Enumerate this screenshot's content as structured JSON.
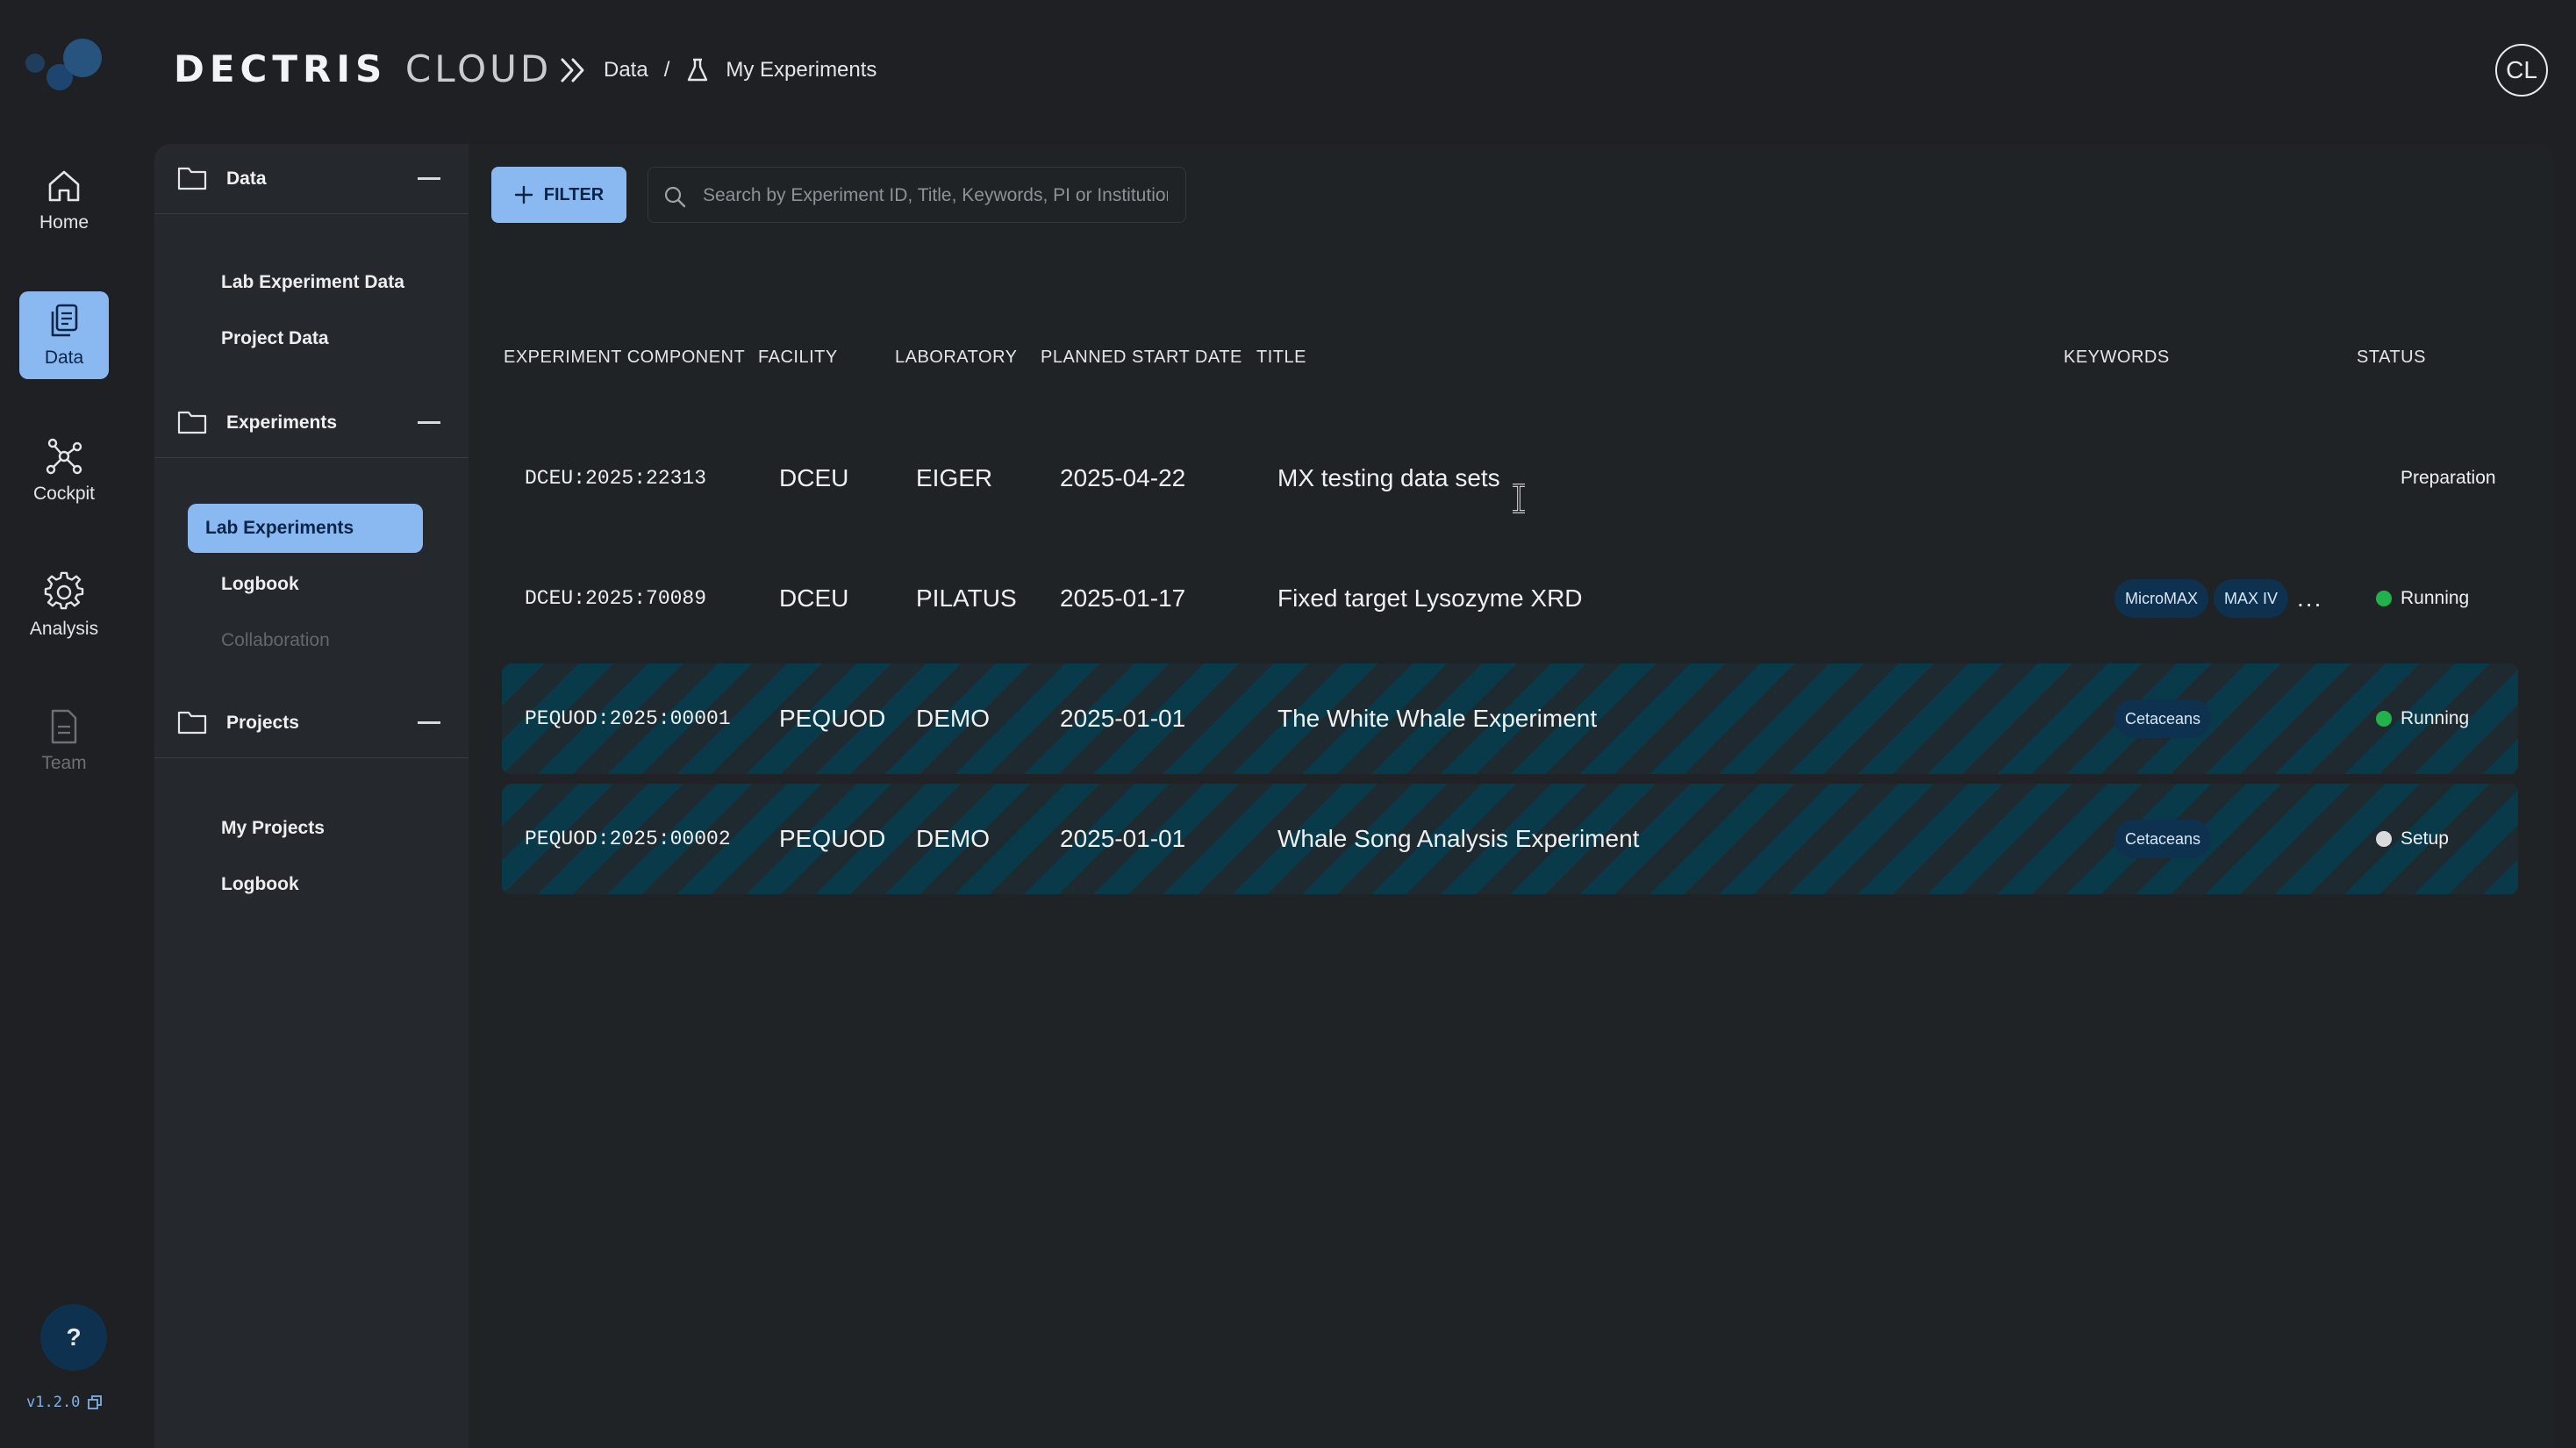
{
  "app": {
    "brand_primary": "DECTRIS",
    "brand_secondary": "CLOUD",
    "avatar_initials": "CL",
    "accent_color": "#8ab9f2"
  },
  "breadcrumb": {
    "items": [
      "Data",
      "My Experiments"
    ],
    "separator": "/"
  },
  "rail": {
    "items": [
      {
        "label": "Home",
        "icon": "home-icon"
      },
      {
        "label": "Data",
        "icon": "documents-icon",
        "active": true
      },
      {
        "label": "Cockpit",
        "icon": "network-icon"
      },
      {
        "label": "Analysis",
        "icon": "gear-icon"
      },
      {
        "label": "Team",
        "icon": "document-icon",
        "disabled": true
      }
    ],
    "help_label": "?",
    "version": "v1.2.0"
  },
  "panel": {
    "data": {
      "title": "Data",
      "items": [
        "Lab Experiment Data",
        "Project Data"
      ]
    },
    "experiments": {
      "title": "Experiments",
      "items": [
        "Lab Experiments",
        "Logbook",
        "Collaboration"
      ],
      "active": "Lab Experiments",
      "disabled": "Collaboration"
    },
    "projects": {
      "title": "Projects",
      "items": [
        "My Projects",
        "Logbook"
      ]
    }
  },
  "toolbar": {
    "filter_label": "FILTER",
    "search_placeholder": "Search by Experiment ID, Title, Keywords, PI or Institution"
  },
  "table": {
    "headers": [
      "EXPERIMENT COMPONENT",
      "FACILITY",
      "LABORATORY",
      "PLANNED START DATE",
      "TITLE",
      "KEYWORDS",
      "STATUS"
    ],
    "rows": [
      {
        "component": "DCEU:2025:22313",
        "facility": "DCEU",
        "laboratory": "EIGER",
        "start": "2025-04-22",
        "title": "MX testing data sets",
        "keywords": [],
        "more": "",
        "status": "Preparation",
        "status_color": "",
        "striped": false
      },
      {
        "component": "DCEU:2025:70089",
        "facility": "DCEU",
        "laboratory": "PILATUS",
        "start": "2025-01-17",
        "title": "Fixed target Lysozyme XRD",
        "keywords": [
          "MicroMAX",
          "MAX IV"
        ],
        "more": "...",
        "status": "Running",
        "status_color": "#22b24c",
        "striped": false
      },
      {
        "component": "PEQUOD:2025:00001",
        "facility": "PEQUOD",
        "laboratory": "DEMO",
        "start": "2025-01-01",
        "title": "The White Whale Experiment",
        "keywords": [
          "Cetaceans"
        ],
        "more": "",
        "status": "Running",
        "status_color": "#22b24c",
        "striped": true
      },
      {
        "component": "PEQUOD:2025:00002",
        "facility": "PEQUOD",
        "laboratory": "DEMO",
        "start": "2025-01-01",
        "title": "Whale Song Analysis Experiment",
        "keywords": [
          "Cetaceans"
        ],
        "more": "",
        "status": "Setup",
        "status_color": "#d9dadc",
        "striped": true
      }
    ]
  }
}
